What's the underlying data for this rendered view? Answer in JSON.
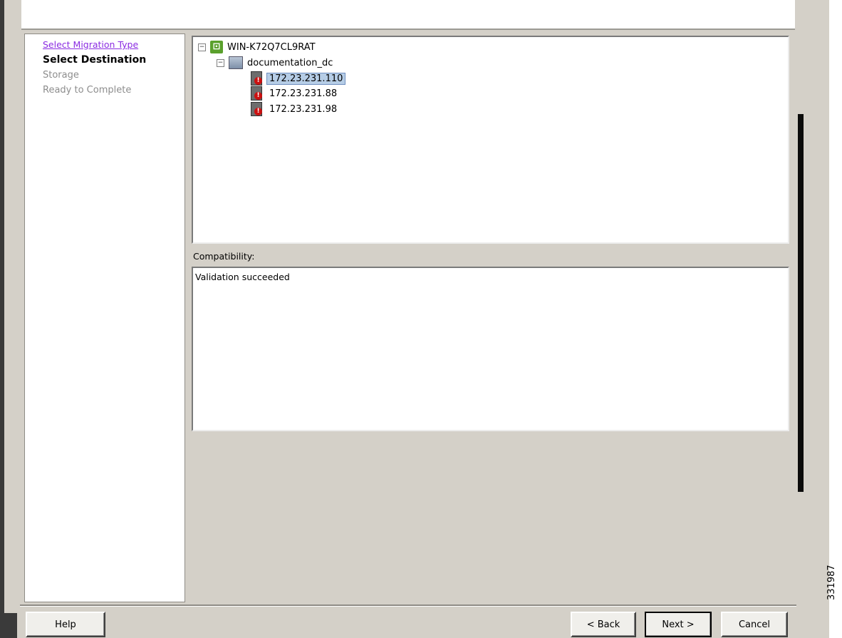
{
  "wizard": {
    "steps": [
      {
        "label": "Select Migration Type",
        "state": "visited"
      },
      {
        "label": "Select Destination",
        "state": "current"
      },
      {
        "label": "Storage",
        "state": "pending"
      },
      {
        "label": "Ready to Complete",
        "state": "pending"
      }
    ]
  },
  "tree": {
    "vcenter": {
      "label": "WIN-K72Q7CL9RAT",
      "expanded": true
    },
    "datacenter": {
      "label": "documentation_dc",
      "expanded": true
    },
    "hosts": [
      {
        "label": "172.23.231.110",
        "selected": true
      },
      {
        "label": "172.23.231.88",
        "selected": false
      },
      {
        "label": "172.23.231.98",
        "selected": false
      }
    ]
  },
  "compatibility": {
    "label": "Compatibility:",
    "message": "Validation succeeded"
  },
  "buttons": {
    "help": "Help",
    "back": "< Back",
    "next": "Next >",
    "cancel": "Cancel"
  },
  "figure_id": "331987",
  "colors": {
    "selection": "#b6cde6",
    "visited_link": "#8a2be2",
    "dialog_bg": "#d4d0c8"
  }
}
